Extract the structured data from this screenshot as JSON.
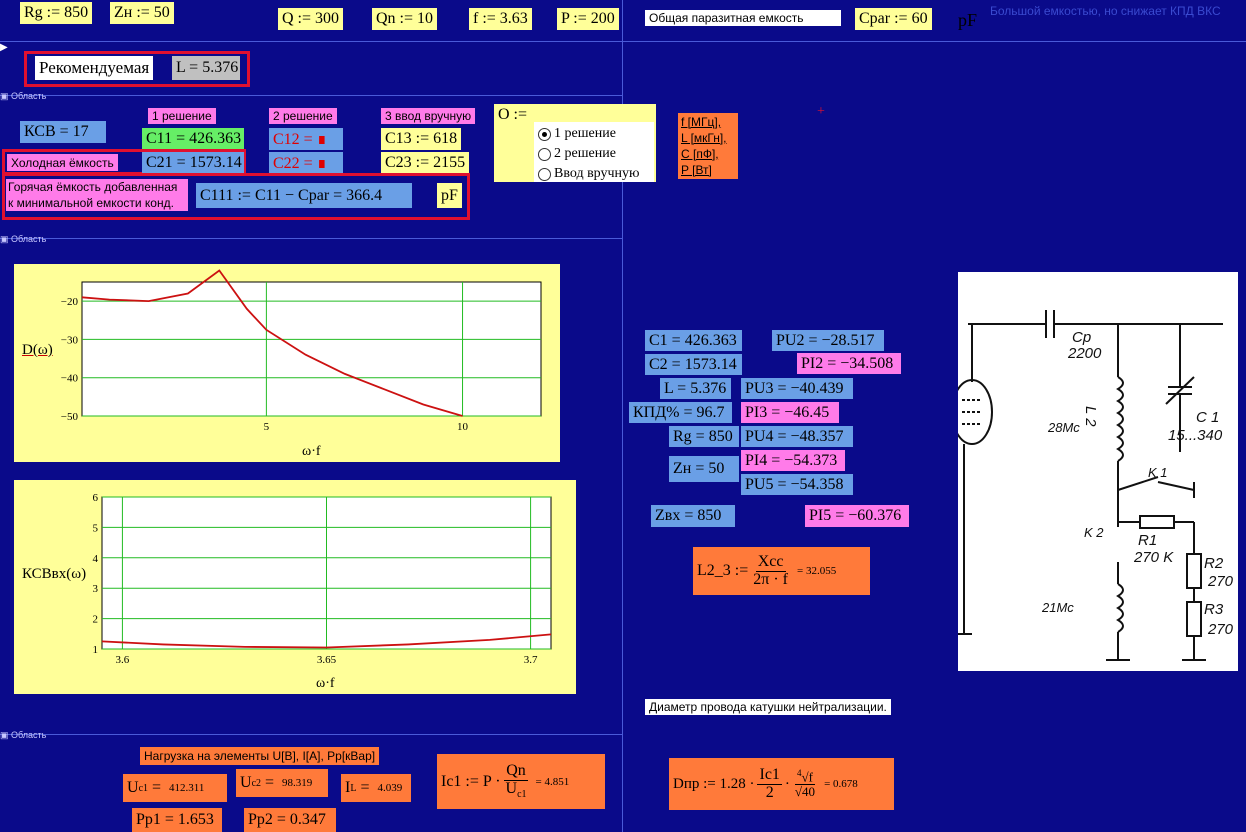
{
  "top": {
    "rg": "Rg := 850",
    "zn": "Zн := 50",
    "q": "Q := 300",
    "qn": "Qn := 10",
    "f": "f := 3.63",
    "p": "P := 200",
    "parasitic_label": "Общая паразитная емкость",
    "cpar": "Cpar := 60",
    "pf_unit": "pF",
    "note": "Большой емкостью, но снижает КПД ВКС"
  },
  "recommended": {
    "label": "Рекомендуемая",
    "value": "L = 5.376"
  },
  "solutions": {
    "s1_label": "1 решение",
    "s2_label": "2 решение",
    "s3_label": "3 ввод вручную",
    "kcv": "КСВ = 17",
    "c11": "C11 = 426.363",
    "c12": "C12 = ∎",
    "c13": "C13 := 618",
    "cold_label": "Холодная ёмкость",
    "c21": "C21 = 1573.14",
    "c22": "C22 = ∎",
    "c23": "C23 := 2155",
    "hot_label_1": "Горячая ёмкость добавленная",
    "hot_label_2": "к минимальной емкости конд.",
    "c111": "C111 := C11 − Cpar = 366.4",
    "pf": "pF"
  },
  "options": {
    "label": "O :=",
    "items": [
      "1 решение",
      "2 решение",
      "Ввод вручную"
    ],
    "selected_index": 0
  },
  "units_box": [
    "f [МГц],",
    "L [мкГн],",
    "C [пФ],",
    "P [Вт]"
  ],
  "results": {
    "c1": "C1 = 426.363",
    "c2": "C2 = 1573.14",
    "l": "L = 5.376",
    "kpd": "КПД% = 96.7",
    "rg": "Rg = 850",
    "zn": "Zн = 50",
    "zbx": "Zвх = 850",
    "pu2": "PU2 = −28.517",
    "pi2": "PI2 = −34.508",
    "pu3": "PU3 = −40.439",
    "pi3": "PI3 = −46.45",
    "pu4": "PU4 = −48.357",
    "pi4": "PI4 = −54.373",
    "pu5": "PU5 = −54.358",
    "pi5": "PI5 = −60.376"
  },
  "l23": {
    "lhs": "L2_3 :=",
    "num": "Xcc",
    "den": "2π · f",
    "val": "= 32.055"
  },
  "wire_label": "Диаметр провода катушки нейтрализации.",
  "bottom": {
    "load_label": "Нагрузка на элементы U[B], I[A], Pp[кВар]",
    "uc1": "412.311",
    "uc2": "98.319",
    "il": "4.039",
    "pp1": "Pp1 = 1.653",
    "pp2": "Pp2 = 0.347",
    "ic1_lhs": "Ic1 := P ·",
    "ic1_num": "Qn",
    "ic1_val": "= 4.851",
    "dpr_lhs": "Dпр := 1.28 ·",
    "dpr_num": "Ic1",
    "dpr_den": "2",
    "dpr_val": "= 0.678"
  },
  "chart_data": [
    {
      "type": "line",
      "ylabel": "D(ω)",
      "xlabel": "ω·f",
      "xlim": [
        0.3,
        12.0
      ],
      "ylim": [
        -50,
        -15
      ],
      "x_ticks": [
        5,
        10
      ],
      "y_ticks": [
        -20,
        -30,
        -40,
        -50
      ],
      "series": [
        {
          "x": [
            0.3,
            1,
            2,
            3,
            3.8,
            4.5,
            5,
            6,
            7,
            8,
            9,
            10
          ],
          "y": [
            -19,
            -19.6,
            -20,
            -18,
            -12,
            -22,
            -27.5,
            -34,
            -39,
            -43,
            -47,
            -50
          ]
        }
      ]
    },
    {
      "type": "line",
      "ylabel": "КСВвх(ω)",
      "xlabel": "ω·f",
      "xlim": [
        3.595,
        3.705
      ],
      "ylim": [
        1,
        6
      ],
      "x_ticks": [
        3.6,
        3.65,
        3.7
      ],
      "y_ticks": [
        1,
        2,
        3,
        4,
        5,
        6
      ],
      "series": [
        {
          "x": [
            3.595,
            3.61,
            3.63,
            3.65,
            3.67,
            3.69,
            3.705
          ],
          "y": [
            1.25,
            1.15,
            1.07,
            1.05,
            1.15,
            1.3,
            1.48
          ]
        }
      ]
    }
  ]
}
